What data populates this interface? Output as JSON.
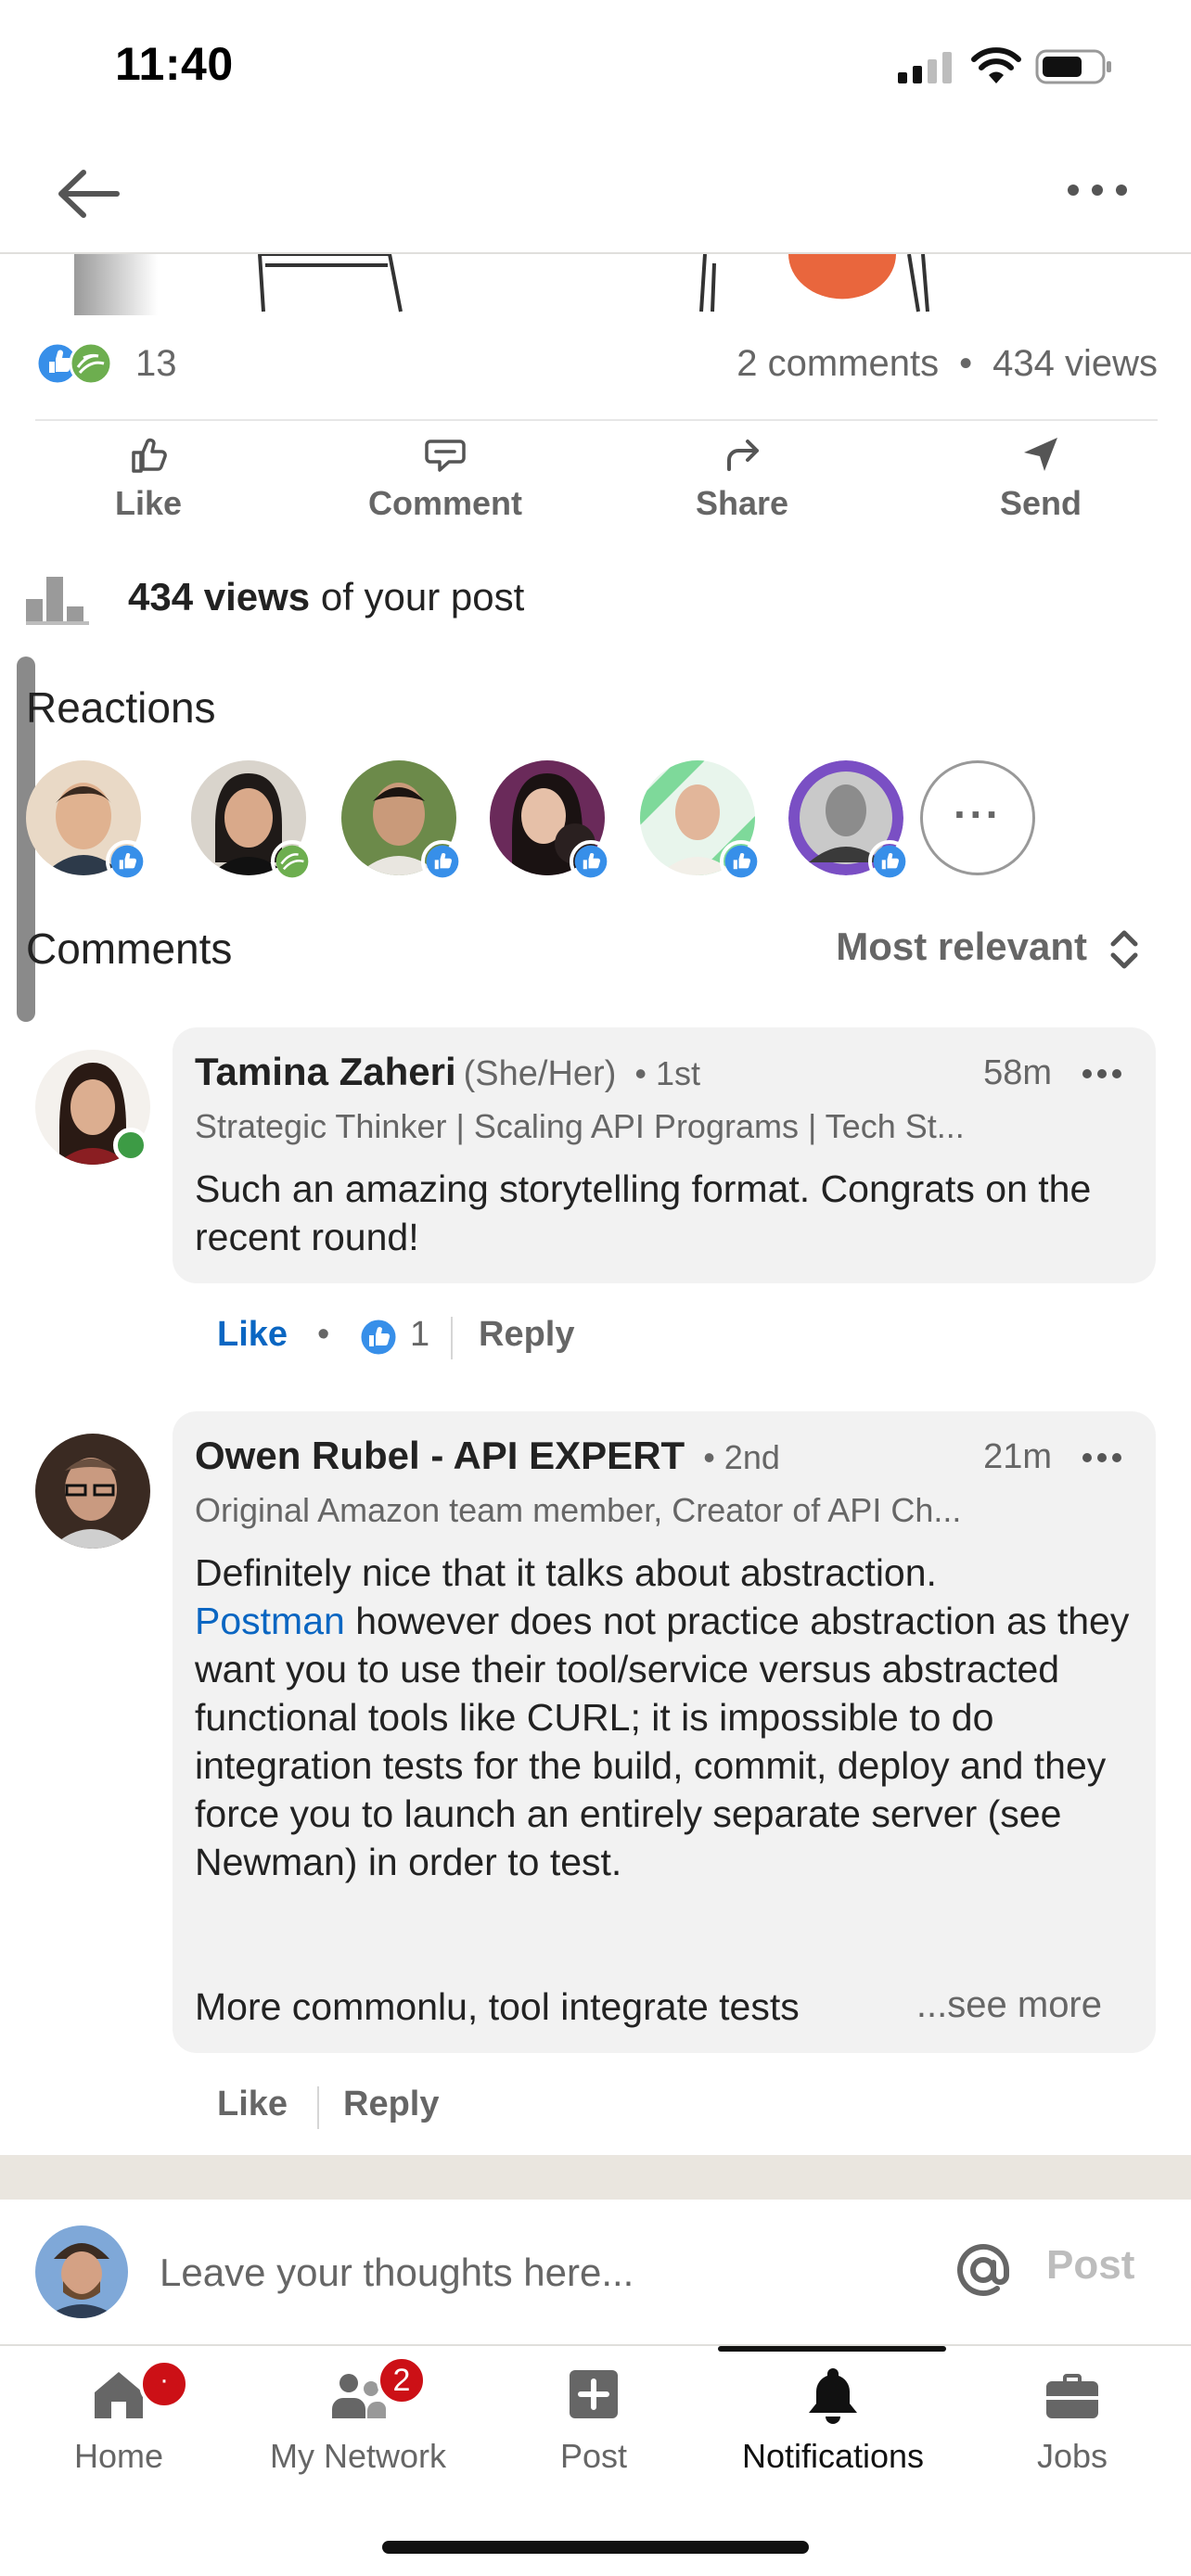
{
  "status_bar": {
    "time": "11:40"
  },
  "post_stats": {
    "reaction_count": "13",
    "comments": "2 comments",
    "separator": "•",
    "views": "434 views"
  },
  "actions": {
    "like": "Like",
    "comment": "Comment",
    "share": "Share",
    "send": "Send"
  },
  "views_summary": {
    "bold": "434 views",
    "rest": " of your post"
  },
  "reactions": {
    "heading": "Reactions",
    "more_label": "···",
    "people": [
      {
        "icon": "like-icon",
        "color": "#378fe9"
      },
      {
        "icon": "support-icon",
        "color": "#6dae4f"
      },
      {
        "icon": "like-icon",
        "color": "#378fe9"
      },
      {
        "icon": "like-icon",
        "color": "#378fe9"
      },
      {
        "icon": "like-icon",
        "color": "#378fe9"
      },
      {
        "icon": "like-icon",
        "color": "#378fe9"
      }
    ]
  },
  "comments_section": {
    "heading": "Comments",
    "sort_label": "Most relevant",
    "items": [
      {
        "name": "Tamina Zaheri",
        "pronoun": "(She/Her)",
        "degree": "• 1st",
        "time": "58m",
        "headline": "Strategic Thinker | Scaling API Programs | Tech St...",
        "text": "Such an amazing storytelling format. Congrats on the recent round!",
        "like_label": "Like",
        "like_count": "1",
        "dot": "•",
        "reply_label": "Reply"
      },
      {
        "name": "Owen Rubel - API EXPERT",
        "degree": "• 2nd",
        "time": "21m",
        "headline": "Original Amazon team member, Creator of API Ch...",
        "text_line1": "Definitely nice that it talks about abstraction.",
        "text_link": "Postman",
        "text_rest": " however does not practice abstraction as they want you to use their tool/service versus abstracted functional tools like CURL; it is impossible to do integration tests for the build, commit, deploy and they force you to launch an entirely separate server (see Newman) in order to test.",
        "text_last": "More commonlu, tool integrate tests",
        "see_more": "...see more",
        "like_label": "Like",
        "reply_label": "Reply"
      }
    ]
  },
  "compose": {
    "placeholder": "Leave your thoughts here...",
    "post_label": "Post"
  },
  "tab_bar": {
    "tabs": [
      {
        "label": "Home",
        "badge": "·"
      },
      {
        "label": "My Network",
        "badge": "2"
      },
      {
        "label": "Post"
      },
      {
        "label": "Notifications",
        "active": true
      },
      {
        "label": "Jobs"
      }
    ]
  },
  "colors": {
    "linkedin_blue": "#0a66c2",
    "notification_red": "#cc1016",
    "online_green": "#3d9b45"
  }
}
